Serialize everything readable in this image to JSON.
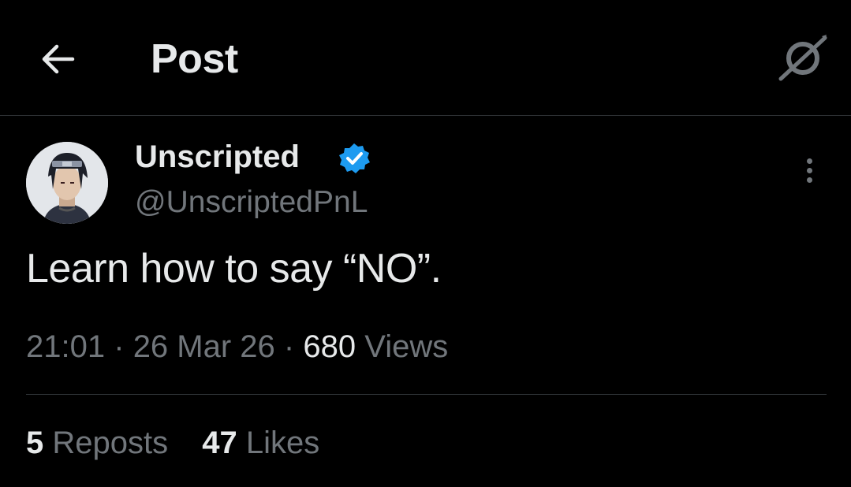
{
  "header": {
    "title": "Post",
    "back_icon": "arrow-left-icon",
    "grok_icon": "grok-slash-icon"
  },
  "author": {
    "name": "Unscripted",
    "handle": "@UnscriptedPnL",
    "verified": true,
    "verified_color": "#1d9bf0"
  },
  "post": {
    "text": "Learn how to say “NO”.",
    "time": "21:01",
    "separator": "·",
    "date": "26 Mar 26",
    "views_count": "680",
    "views_label": "Views"
  },
  "stats": {
    "reposts_count": "5",
    "reposts_label": "Reposts",
    "likes_count": "47",
    "likes_label": "Likes"
  }
}
